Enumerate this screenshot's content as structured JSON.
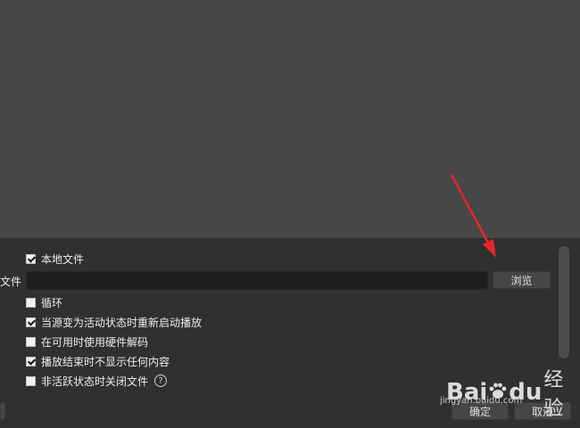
{
  "source_settings": {
    "local_file": {
      "label": "本地文件",
      "checked": true
    },
    "file_label": "文件",
    "file_path": "",
    "browse_label": "浏览",
    "options": [
      {
        "label": "循环",
        "checked": false
      },
      {
        "label": "当源变为活动状态时重新启动播放",
        "checked": true
      },
      {
        "label": "在可用时使用硬件解码",
        "checked": false
      },
      {
        "label": "播放结束时不显示任何内容",
        "checked": true
      },
      {
        "label": "非活跃状态时关闭文件",
        "checked": false
      }
    ],
    "help_glyph": "?"
  },
  "dialog_buttons": {
    "ok": "确定",
    "cancel": "取消"
  },
  "annotation": {
    "arrow_color": "#e8242a"
  },
  "watermark": {
    "brand": "Bai",
    "brand2": "du",
    "suffix": "经验",
    "url": "jingyan.baidu.com"
  }
}
